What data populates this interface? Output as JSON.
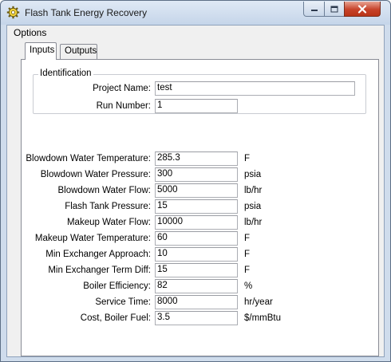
{
  "window": {
    "title": "Flash Tank Energy Recovery"
  },
  "menu": {
    "options": "Options"
  },
  "tabs": {
    "inputs": "Inputs",
    "outputs": "Outputs"
  },
  "identification": {
    "legend": "Identification",
    "project_name_label": "Project Name:",
    "project_name_value": "test",
    "run_number_label": "Run Number:",
    "run_number_value": "1"
  },
  "inputs": [
    {
      "label": "Blowdown Water Temperature:",
      "value": "285.3",
      "unit": "F"
    },
    {
      "label": "Blowdown Water Pressure:",
      "value": "300",
      "unit": "psia"
    },
    {
      "label": "Blowdown Water Flow:",
      "value": "5000",
      "unit": "lb/hr"
    },
    {
      "label": "Flash Tank Pressure:",
      "value": "15",
      "unit": "psia"
    },
    {
      "label": "Makeup Water Flow:",
      "value": "10000",
      "unit": "lb/hr"
    },
    {
      "label": "Makeup Water Temperature:",
      "value": "60",
      "unit": "F"
    },
    {
      "label": "Min Exchanger Approach:",
      "value": "10",
      "unit": "F"
    },
    {
      "label": "Min Exchanger Term Diff:",
      "value": "15",
      "unit": "F"
    },
    {
      "label": "Boiler Efficiency:",
      "value": "82",
      "unit": "%"
    },
    {
      "label": "Service Time:",
      "value": "8000",
      "unit": "hr/year"
    },
    {
      "label": "Cost, Boiler Fuel:",
      "value": "3.5",
      "unit": "$/mmBtu"
    }
  ],
  "icons": {
    "app": "gear-icon",
    "minimize": "minimize-icon",
    "maximize": "maximize-icon",
    "close": "close-icon"
  },
  "colors": {
    "close_button": "#c7432a",
    "frame": "#cfdcec"
  }
}
